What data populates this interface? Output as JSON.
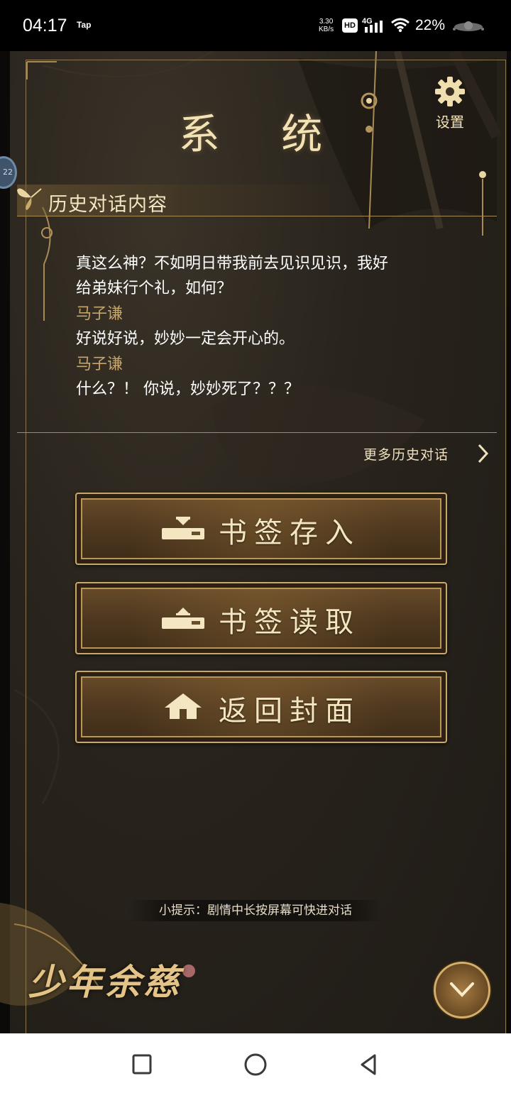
{
  "status_bar": {
    "time": "04:17",
    "app_tag": "Tap",
    "net_speed_value": "3.30",
    "net_speed_unit": "KB/s",
    "hd_badge": "HD",
    "network_type": "4G",
    "battery": "22%"
  },
  "game": {
    "title": "系 统",
    "settings_label": "设置",
    "history": {
      "title": "历史对话内容",
      "entries": [
        {
          "type": "line",
          "text": "真这么神？不如明日带我前去见识见识，我好"
        },
        {
          "type": "line",
          "text": "给弟妹行个礼，如何？"
        },
        {
          "type": "speaker",
          "text": "马子谦"
        },
        {
          "type": "line",
          "text": "好说好说，妙妙一定会开心的。"
        },
        {
          "type": "speaker",
          "text": "马子谦"
        },
        {
          "type": "line",
          "text": "什么？！ 你说，妙妙死了？？？"
        }
      ]
    },
    "more_history_label": "更多历史对话",
    "menu_buttons": [
      {
        "label": "书签存入",
        "icon": "bookmark-save-icon"
      },
      {
        "label": "书签读取",
        "icon": "bookmark-load-icon"
      },
      {
        "label": "返回封面",
        "icon": "home-icon"
      }
    ],
    "tip": "小提示：剧情中长按屏幕可快进对话",
    "logo_text": "少年余慈",
    "edge_bubble_text": "22"
  },
  "colors": {
    "accent_gold": "#c8a869",
    "speaker_color": "#c7a66d",
    "panel_bg": "#29241d"
  }
}
